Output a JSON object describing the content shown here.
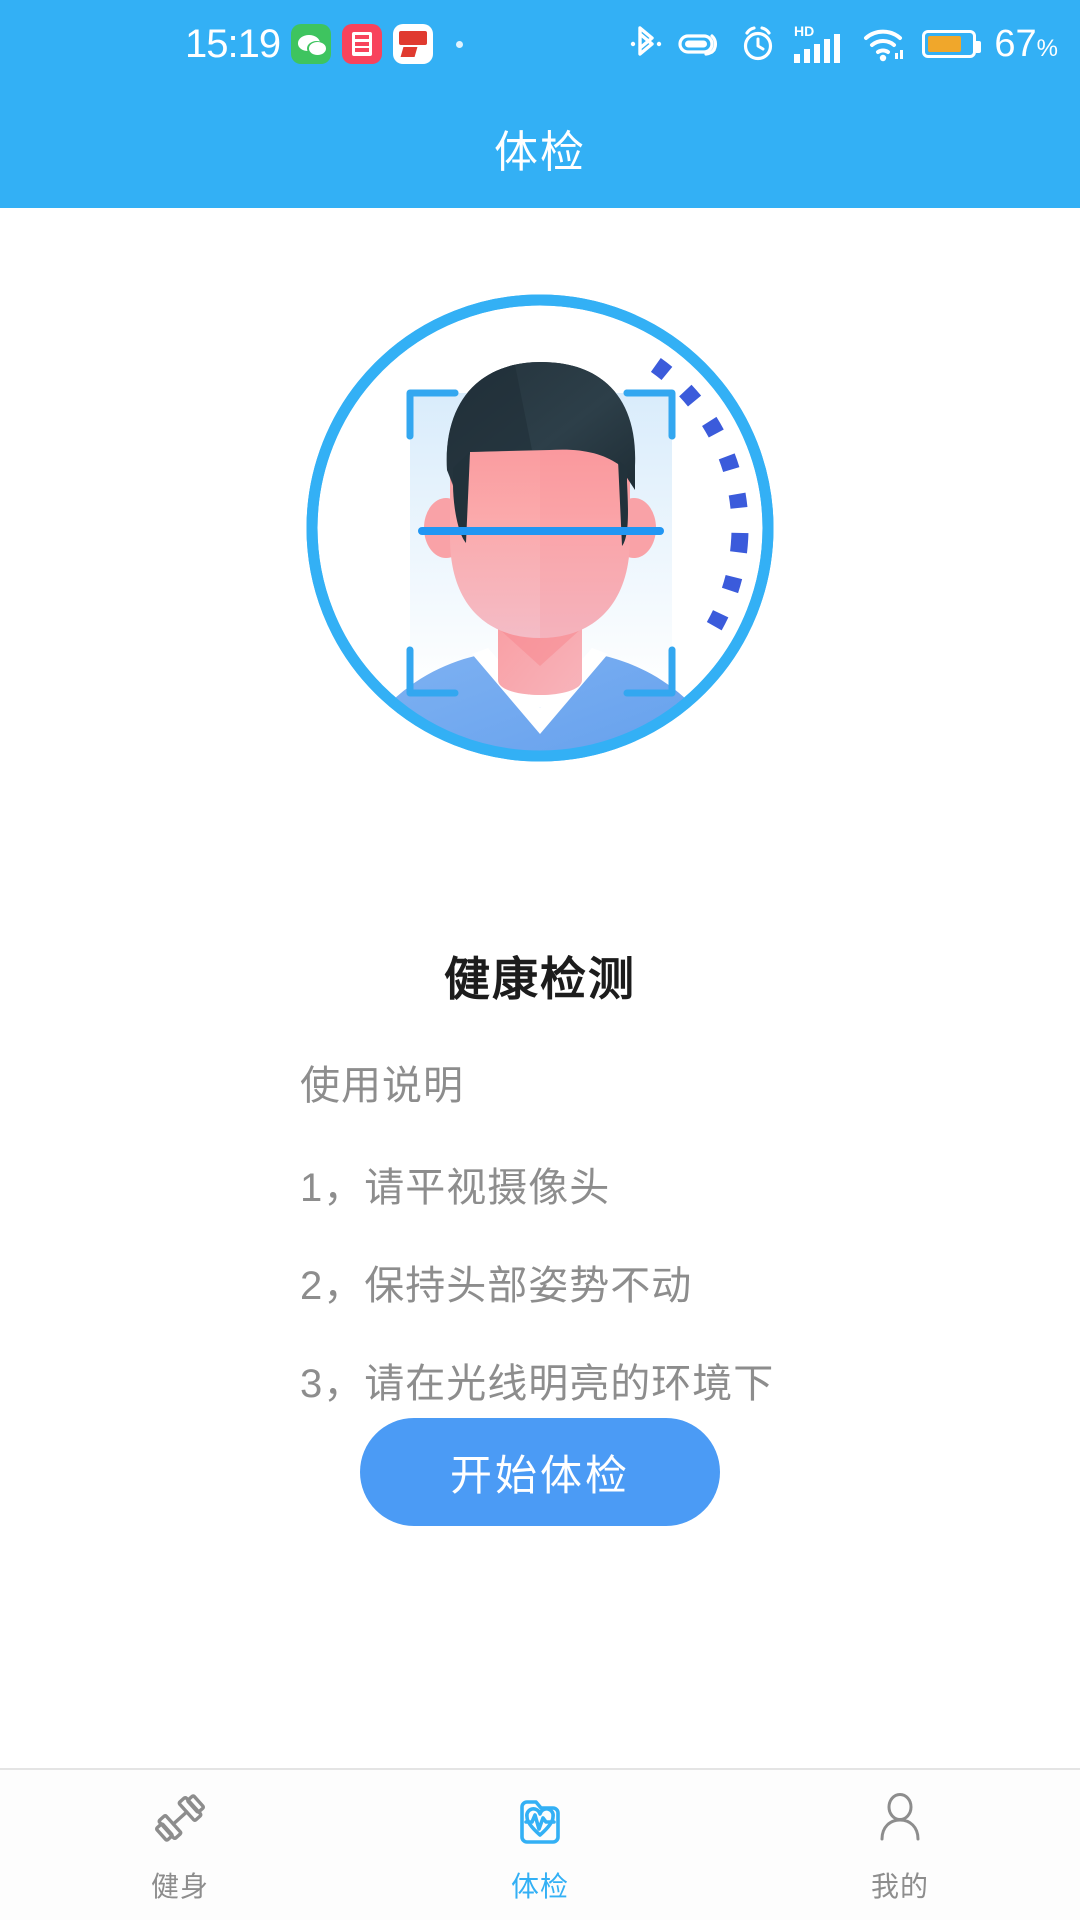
{
  "statusbar": {
    "time": "15:19",
    "battery_percent": "67",
    "battery_unit": "%",
    "battery_level": 67,
    "left_icons": [
      "wechat-icon",
      "notes-icon",
      "alipay-icon",
      "more-dot-icon"
    ],
    "right_icons": [
      "bluetooth-icon",
      "headset-icon",
      "alarm-icon",
      "hd-signal-icon",
      "wifi-icon",
      "battery-icon"
    ],
    "hd_label": "HD"
  },
  "header": {
    "title": "体检"
  },
  "hero": {
    "illustration_name": "face-scan-illustration",
    "ring_color": "#33b0f5",
    "dash_color": "#3b5bdb",
    "frame_color": "#33a7f0",
    "skin_color": "#f79a9e",
    "hair_color": "#2b3a44",
    "shirt_color": "#6ea8f0"
  },
  "main": {
    "title": "健康检测",
    "instructions_heading": "使用说明",
    "instructions": [
      "1，请平视摄像头",
      "2，保持头部姿势不动",
      "3，请在光线明亮的环境下"
    ],
    "start_button": "开始体检",
    "accent_color": "#4b9bf5"
  },
  "tabbar": {
    "items": [
      {
        "label": "健身",
        "icon": "dumbbell-icon",
        "active": false
      },
      {
        "label": "体检",
        "icon": "medical-heart-icon",
        "active": true
      },
      {
        "label": "我的",
        "icon": "person-icon",
        "active": false
      }
    ],
    "active_color": "#33b0f5",
    "inactive_color": "#8d8d8d"
  }
}
